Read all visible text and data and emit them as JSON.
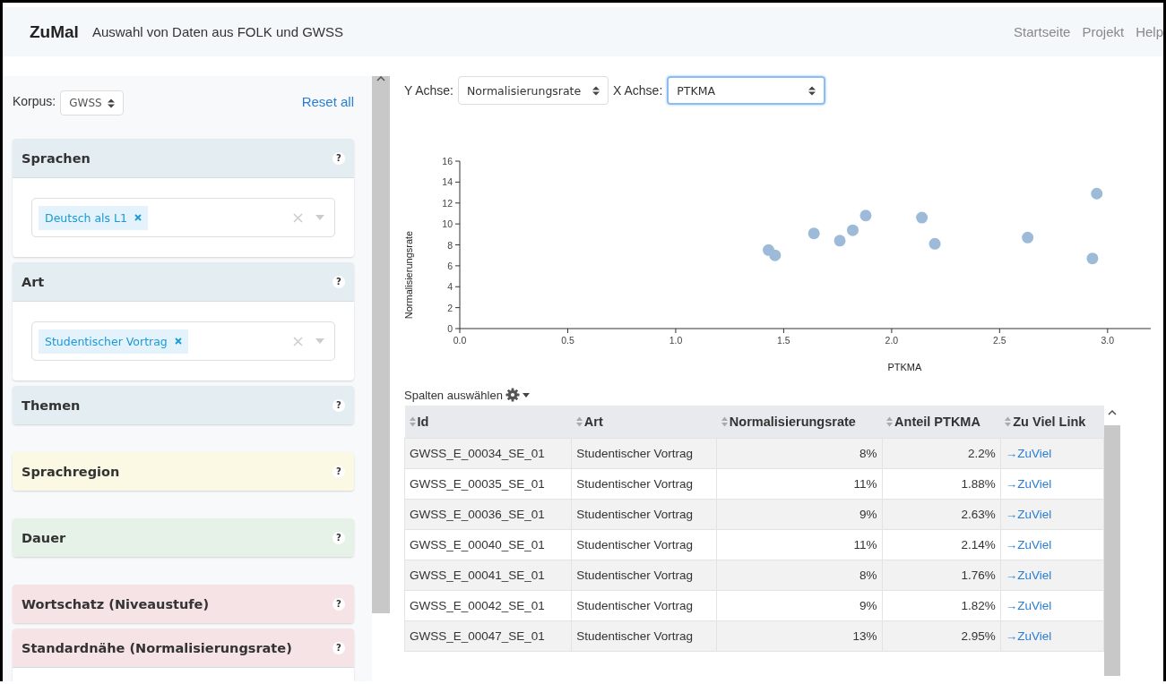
{
  "navbar": {
    "brand": "ZuMal",
    "subtitle": "Auswahl von Daten aus FOLK und GWSS",
    "links": [
      "Startseite",
      "Projekt",
      "Help"
    ]
  },
  "sidebar": {
    "korpus_label": "Korpus:",
    "korpus_value": "GWSS",
    "reset": "Reset all",
    "panels": [
      {
        "title": "Sprachen",
        "help": "?",
        "color": "#e3edf2",
        "expanded": true,
        "tags": [
          "Deutsch als L1"
        ]
      },
      {
        "title": "Art",
        "help": "?",
        "color": "#e3edf2",
        "expanded": true,
        "tags": [
          "Studentischer Vortrag"
        ]
      },
      {
        "title": "Themen",
        "help": "?",
        "color": "#e3edf2",
        "expanded": false
      },
      {
        "title": "Sprachregion",
        "help": "?",
        "color": "#fbf8e3",
        "expanded": false
      },
      {
        "title": "Dauer",
        "help": "?",
        "color": "#e6f1e7",
        "expanded": false
      },
      {
        "title": "Wortschatz (Niveaustufe)",
        "help": "?",
        "color": "#f6e3e5",
        "expanded": false
      },
      {
        "title": "Standardnähe (Normalisierungsrate)",
        "help": "?",
        "color": "#f6e3e5",
        "expanded": true
      }
    ]
  },
  "axes": {
    "y_label": "Y Achse:",
    "y_value": "Normalisierungsrate",
    "y_focused": false,
    "x_label": "X Achse:",
    "x_value": "PTKMA",
    "x_focused": true
  },
  "chart": {
    "chart_data": {
      "type": "scatter",
      "xlabel": "PTKMA",
      "ylabel": "Normalisierungsrate",
      "xlim": [
        0,
        3.2
      ],
      "ylim": [
        0,
        16
      ],
      "xticks": [
        {
          "value": 0,
          "label": "0.0"
        },
        {
          "value": 0.5,
          "label": "0.5"
        },
        {
          "value": 1,
          "label": "1.0"
        },
        {
          "value": 1.5,
          "label": "1.5"
        },
        {
          "value": 2,
          "label": "2.0"
        },
        {
          "value": 2.5,
          "label": "2.5"
        },
        {
          "value": 3,
          "label": "3.0"
        }
      ],
      "yticks": [
        0,
        2,
        4,
        6,
        8,
        10,
        12,
        14,
        16
      ],
      "series": [
        {
          "color": "#9dbbd8",
          "x": [
            1.43,
            1.46,
            1.64,
            1.76,
            1.82,
            1.88,
            2.14,
            2.2,
            2.63,
            2.93,
            2.95
          ],
          "values": [
            7.5,
            7.0,
            9.1,
            8.4,
            9.4,
            10.8,
            10.6,
            8.1,
            8.7,
            6.7,
            12.9
          ]
        }
      ]
    }
  },
  "table": {
    "columns_label": "Spalten auswählen",
    "columns": [
      "Id",
      "Art",
      "Normalisierungsrate",
      "Anteil PTKMA",
      "Zu Viel Link"
    ],
    "rows": [
      [
        "GWSS_E_00034_SE_01",
        "Studentischer Vortrag",
        "8%",
        "2.2%",
        "→ZuViel"
      ],
      [
        "GWSS_E_00035_SE_01",
        "Studentischer Vortrag",
        "11%",
        "1.88%",
        "→ZuViel"
      ],
      [
        "GWSS_E_00036_SE_01",
        "Studentischer Vortrag",
        "9%",
        "2.63%",
        "→ZuViel"
      ],
      [
        "GWSS_E_00040_SE_01",
        "Studentischer Vortrag",
        "11%",
        "2.14%",
        "→ZuViel"
      ],
      [
        "GWSS_E_00041_SE_01",
        "Studentischer Vortrag",
        "8%",
        "1.76%",
        "→ZuViel"
      ],
      [
        "GWSS_E_00042_SE_01",
        "Studentischer Vortrag",
        "9%",
        "1.82%",
        "→ZuViel"
      ],
      [
        "GWSS_E_00047_SE_01",
        "Studentischer Vortrag",
        "13%",
        "2.95%",
        "→ZuViel"
      ]
    ]
  }
}
